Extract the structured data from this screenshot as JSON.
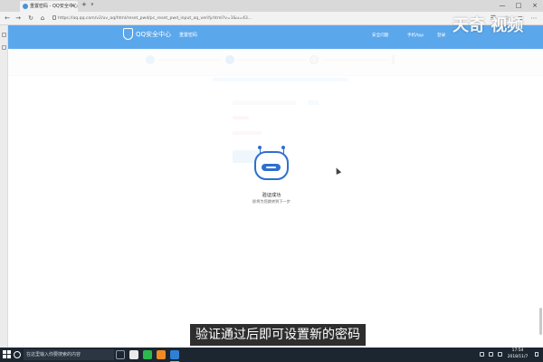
{
  "browser": {
    "tab_title": "重置密码 - QQ安全中心",
    "tab_close": "×",
    "tab_new": "+",
    "tab_list": "∨",
    "url": "https://aq.qq.com/v2/uv_aq/html/reset_pwd/pc_reset_pwd_input_aq_verify.html?v=1&u=43...",
    "window_controls": [
      "—",
      "□",
      "×"
    ]
  },
  "header": {
    "logo_text": "QQ安全中心",
    "page_name": "重置密码",
    "nav": [
      "安全问题",
      "手机App",
      "登录"
    ]
  },
  "modal": {
    "title": "验证成功",
    "subtitle": "即将为您跳转到下一步"
  },
  "caption": "验证通过后即可设置新的密码",
  "watermark": "天奇 视频",
  "taskbar": {
    "search_placeholder": "在这里输入你要搜索的内容",
    "time": "17:54",
    "date": "2018/11/7"
  },
  "colors": {
    "header_blue": "#5ba7ec",
    "robot_blue": "#2e6fd0",
    "taskbar": "#1c2630"
  }
}
